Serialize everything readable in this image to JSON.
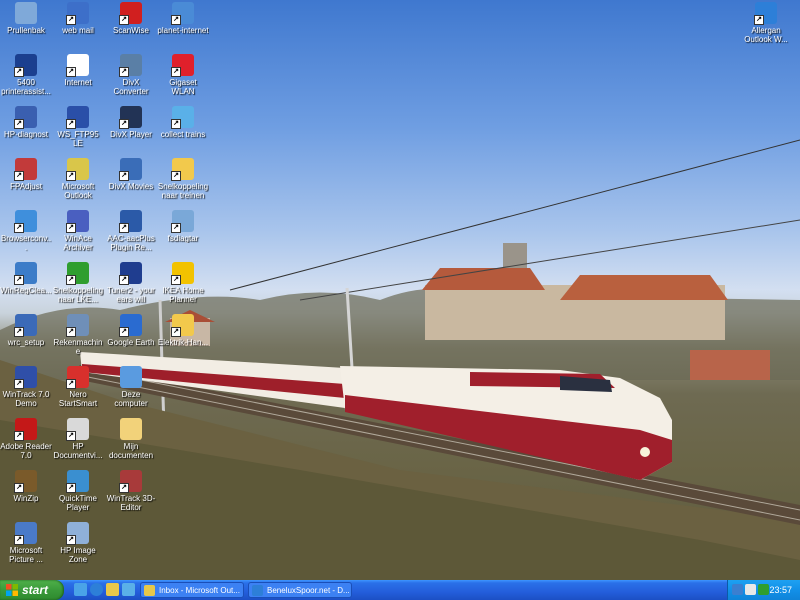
{
  "desktop_icons": [
    {
      "name": "recycle-bin-icon",
      "label": "Prullenbak",
      "color": "#7fa9d9"
    },
    {
      "name": "web-mail-icon",
      "label": "web mail",
      "color": "#3d6fc9"
    },
    {
      "name": "scanwise-icon",
      "label": "ScanWise",
      "color": "#d11f1f"
    },
    {
      "name": "planet-internet-icon",
      "label": "planet-internet",
      "color": "#4a8bd6"
    },
    {
      "name": "printer-assistant-icon",
      "label": "5400 printerassist...",
      "color": "#1b3f8f"
    },
    {
      "name": "internet-icon",
      "label": "Internet",
      "color": "#ffffff"
    },
    {
      "name": "divx-converter-icon",
      "label": "DivX Converter",
      "color": "#5a7fa6"
    },
    {
      "name": "gigaset-wlan-icon",
      "label": "Gigaset WLAN Adapter Mo...",
      "color": "#e0202b"
    },
    {
      "name": "hp-diagnostic-icon",
      "label": "HP-diagnost",
      "color": "#3a5fb0"
    },
    {
      "name": "ws-ftp-icon",
      "label": "WS_FTP95 LE",
      "color": "#2a4fa8"
    },
    {
      "name": "divx-player-icon",
      "label": "DivX Player",
      "color": "#223355"
    },
    {
      "name": "collect-trains-icon",
      "label": "collect trains",
      "color": "#5ab0e8"
    },
    {
      "name": "fpadjust-icon",
      "label": "FPAdjust",
      "color": "#c23a3a"
    },
    {
      "name": "microsoft-outlook-icon",
      "label": "Microsoft Outlook",
      "color": "#d9c64a"
    },
    {
      "name": "divx-movies-icon",
      "label": "DivX Movies",
      "color": "#3a6db8"
    },
    {
      "name": "snelkoppeling-treinen-icon",
      "label": "Snelkoppeling naar treinen",
      "color": "#f2c94c"
    },
    {
      "name": "browser-config-icon",
      "label": "Browserconv...",
      "color": "#3f8fdc"
    },
    {
      "name": "winace-archiver-icon",
      "label": "WinAce Archiver",
      "color": "#4a5fc0"
    },
    {
      "name": "aac-aacplus-plugin-icon",
      "label": "AAC-aacPlus Plugin Re...",
      "color": "#2b5aa8"
    },
    {
      "name": "fsdiagtar-icon",
      "label": "fsdiagtar",
      "color": "#7aa8d8"
    },
    {
      "name": "winregclean-icon",
      "label": "WinRegClea...",
      "color": "#3c7cc8"
    },
    {
      "name": "snelkoppeling-lk-icon",
      "label": "Snelkoppeling naar LKE...",
      "color": "#2f9e2f"
    },
    {
      "name": "tuner2-icon",
      "label": "Tuner2 - your ears will now...",
      "color": "#1f3d8f"
    },
    {
      "name": "ikea-home-planner-icon",
      "label": "IKEA Home Planner",
      "color": "#f2c200"
    },
    {
      "name": "wrc-setup-icon",
      "label": "wrc_setup",
      "color": "#3b6ab8"
    },
    {
      "name": "rekenmachine-icon",
      "label": "Rekenmachine",
      "color": "#6f8fb8"
    },
    {
      "name": "google-earth-icon",
      "label": "Google Earth",
      "color": "#2a6bd0"
    },
    {
      "name": "elektrik-handbuch-icon",
      "label": "Elektrik-Han...",
      "color": "#f2c94c"
    },
    {
      "name": "wintrack-demo-icon",
      "label": "WinTrack 7.0 Demo",
      "color": "#2f4fa8"
    },
    {
      "name": "nero-startsmart-icon",
      "label": "Nero StartSmart",
      "color": "#d8302c"
    },
    {
      "name": "deze-computer-icon",
      "label": "Deze computer",
      "color": "#5a9be0"
    },
    {
      "name": "adobe-reader-icon",
      "label": "Adobe Reader 7.0",
      "color": "#c41818"
    },
    {
      "name": "hp-documentviewer-icon",
      "label": "HP Documentvi...",
      "color": "#d9d9d9"
    },
    {
      "name": "mijn-documenten-icon",
      "label": "Mijn documenten",
      "color": "#f2d27a"
    },
    {
      "name": "winzip-icon",
      "label": "WinZip",
      "color": "#7a5a2a"
    },
    {
      "name": "quicktime-player-icon",
      "label": "QuickTime Player",
      "color": "#3a8fd0"
    },
    {
      "name": "wintrack-3d-editor-icon",
      "label": "WinTrack 3D-Editor",
      "color": "#a83a3a"
    },
    {
      "name": "microsoft-picture-icon",
      "label": "Microsoft Picture ...",
      "color": "#4a7ac8"
    },
    {
      "name": "hp-image-zone-icon",
      "label": "HP Image Zone",
      "color": "#8fb0d8"
    },
    {
      "name": "allergan-outlook-icon",
      "label": "Allergan Outlook W...",
      "color": "#2d7fd8"
    }
  ],
  "taskbar": {
    "start_label": "start",
    "tasks": [
      {
        "label": "Inbox - Microsoft Out...",
        "color": "#e8c84a"
      },
      {
        "label": "BeneluxSpoor.net - D...",
        "color": "#2d7fd8"
      }
    ],
    "clock": "23:57"
  },
  "colors": {
    "taskbar_blue": "#245edb",
    "start_green": "#3a9a3a",
    "tray_blue": "#1290e8"
  }
}
